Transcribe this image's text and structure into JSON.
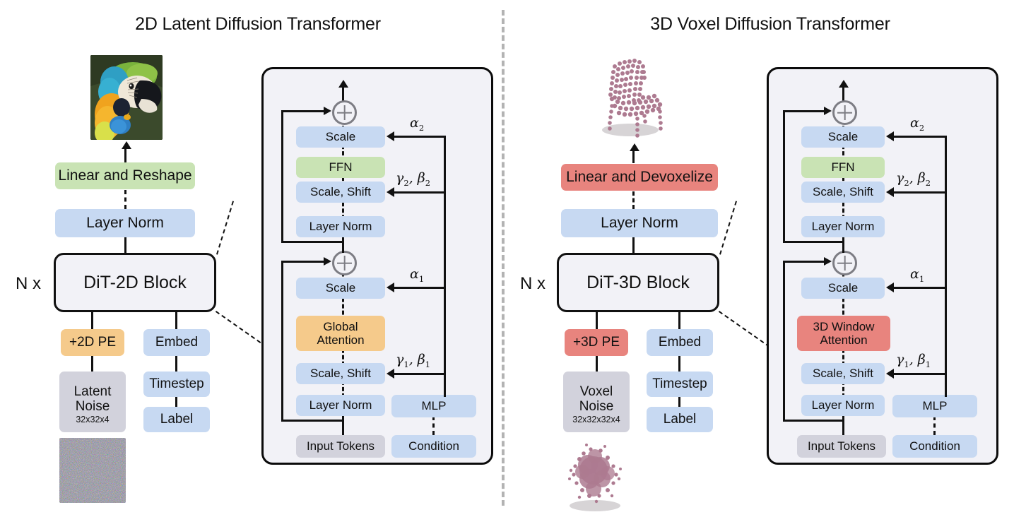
{
  "panels": [
    {
      "id": "left",
      "title": "2D Latent Diffusion Transformer",
      "output_image": "macaw-parrot-photo",
      "pipeline": {
        "head": "Linear and Reshape",
        "norm": "Layer Norm",
        "block": "DiT-2D Block",
        "repeat": "N x",
        "pe": "+2D PE",
        "noise_title_line1": "Latent",
        "noise_title_line2": "Noise",
        "noise_shape": "32x32x4",
        "embed": "Embed",
        "timestep": "Timestep",
        "label": "Label",
        "noise_image": "rgb-latent-noise-swatch"
      },
      "detail": {
        "add_top": "plus-circle",
        "scale2": "Scale",
        "ffn": "FFN",
        "scale_shift2": "Scale, Shift",
        "norm2": "Layer Norm",
        "add_bottom": "plus-circle",
        "scale1": "Scale",
        "attention_line1": "Global",
        "attention_line2": "Attention",
        "scale_shift1": "Scale, Shift",
        "norm1": "Layer Norm",
        "input_tokens": "Input Tokens",
        "mlp": "MLP",
        "condition": "Condition",
        "alpha2": "α",
        "alpha2_sub": "2",
        "gb2": "γ₂, β₂",
        "alpha1": "α",
        "alpha1_sub": "1",
        "gb1": "γ₁, β₁"
      }
    },
    {
      "id": "right",
      "title": "3D Voxel Diffusion Transformer",
      "output_image": "chair-point-cloud",
      "pipeline": {
        "head": "Linear and Devoxelize",
        "norm": "Layer Norm",
        "block": "DiT-3D Block",
        "repeat": "N x",
        "pe": "+3D PE",
        "noise_title_line1": "Voxel",
        "noise_title_line2": "Noise",
        "noise_shape": "32x32x32x4",
        "embed": "Embed",
        "timestep": "Timestep",
        "label": "Label",
        "noise_image": "point-cloud-noise-blob"
      },
      "detail": {
        "add_top": "plus-circle",
        "scale2": "Scale",
        "ffn": "FFN",
        "scale_shift2": "Scale, Shift",
        "norm2": "Layer Norm",
        "add_bottom": "plus-circle",
        "scale1": "Scale",
        "attention_line1": "3D Window",
        "attention_line2": "Attention",
        "scale_shift1": "Scale, Shift",
        "norm1": "Layer Norm",
        "input_tokens": "Input Tokens",
        "mlp": "MLP",
        "condition": "Condition",
        "alpha2": "α",
        "alpha2_sub": "2",
        "gb2": "γ₂, β₂",
        "alpha1": "α",
        "alpha1_sub": "1",
        "gb1": "γ₁, β₁"
      }
    }
  ],
  "colors": {
    "blue": "#c7d9f2",
    "green": "#c9e3b4",
    "orange": "#f5ca8b",
    "red": "#e8847e",
    "grey": "#d2d2dc",
    "shell": "#f2f2f7",
    "outline": "#111111",
    "divider": "#b3b3b3",
    "point_cloud": "#b07d93"
  }
}
